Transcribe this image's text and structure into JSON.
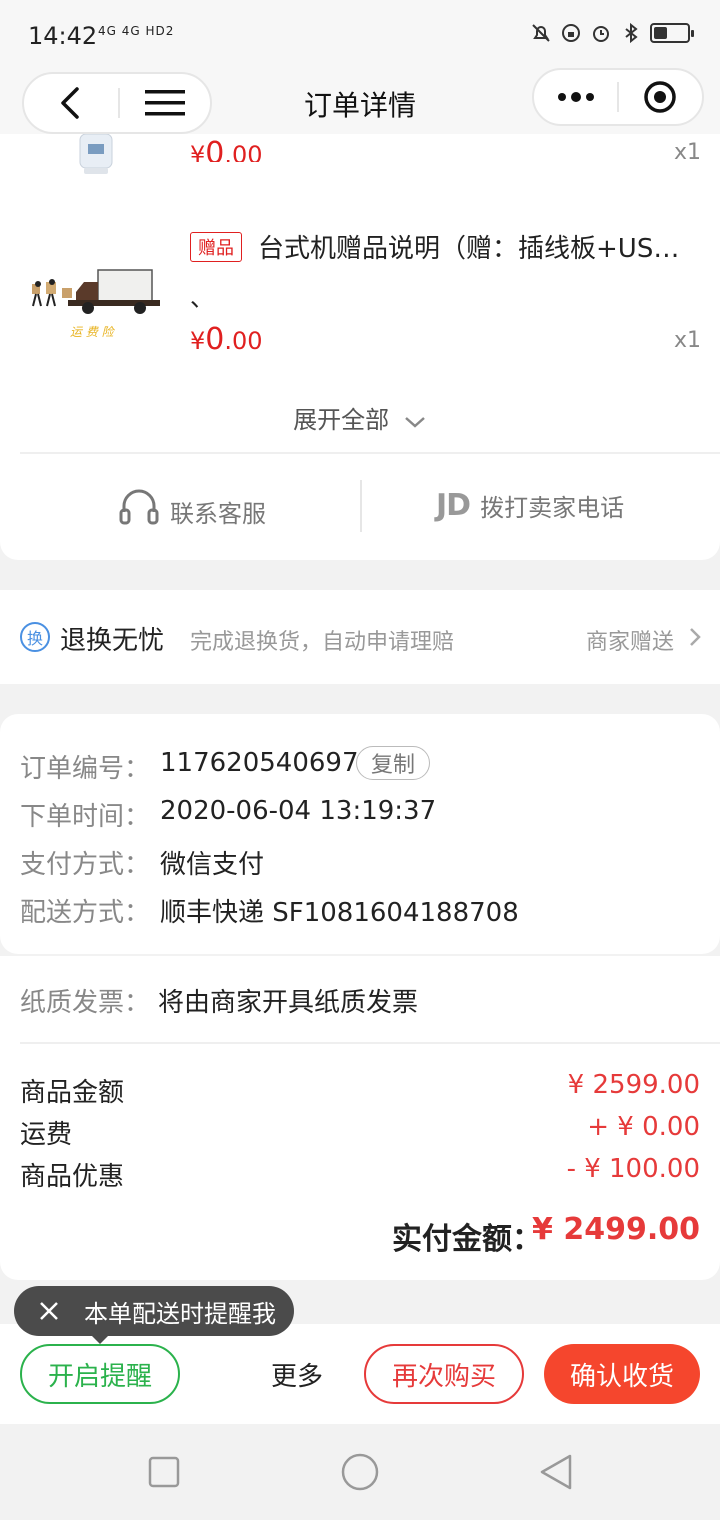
{
  "status_bar": {
    "time": "14:42",
    "network": "4G 4G HD2",
    "battery_level": 0.4
  },
  "header": {
    "title": "订单详情"
  },
  "products": [
    {
      "price_symbol": "¥",
      "price_int": "0",
      "price_dec": ".00",
      "qty": "x1"
    },
    {
      "tag": "赠品",
      "title": "台式机赠品说明（赠：插线板+US…",
      "subtitle": "、",
      "image_caption": "运 费 险",
      "price_symbol": "¥",
      "price_int": "0",
      "price_dec": ".00",
      "qty": "x1"
    }
  ],
  "expand_label": "展开全部",
  "contact": {
    "service_label": "联系客服",
    "seller_phone_label": "拨打卖家电话",
    "jd_logo": "JD"
  },
  "returns": {
    "icon_text": "换",
    "title": "退换无忧",
    "desc": "完成退换货，自动申请理赔",
    "right_label": "商家赠送"
  },
  "order": {
    "number_label": "订单编号：",
    "number": "117620540697",
    "copy_label": "复制",
    "time_label": "下单时间：",
    "time": "2020-06-04 13:19:37",
    "pay_label": "支付方式：",
    "pay": "微信支付",
    "ship_label": "配送方式：",
    "ship": "顺丰快递 SF1081604188708"
  },
  "invoice": {
    "label": "纸质发票：",
    "value": "将由商家开具纸质发票"
  },
  "summary": {
    "goods_label": "商品金额",
    "goods_value": "¥ 2599.00",
    "freight_label": "运费",
    "freight_value": "+ ¥ 0.00",
    "discount_label": "商品优惠",
    "discount_value": "- ¥ 100.00",
    "paid_label": "实付金额：",
    "paid_value": "¥ 2499.00"
  },
  "tooltip": {
    "text": "本单配送时提醒我"
  },
  "actions": {
    "remind": "开启提醒",
    "more": "更多",
    "rebuy": "再次购买",
    "confirm": "确认收货"
  },
  "colors": {
    "red": "#e63a3a",
    "green": "#2bb24c",
    "confirm_bg": "#f5462d"
  }
}
